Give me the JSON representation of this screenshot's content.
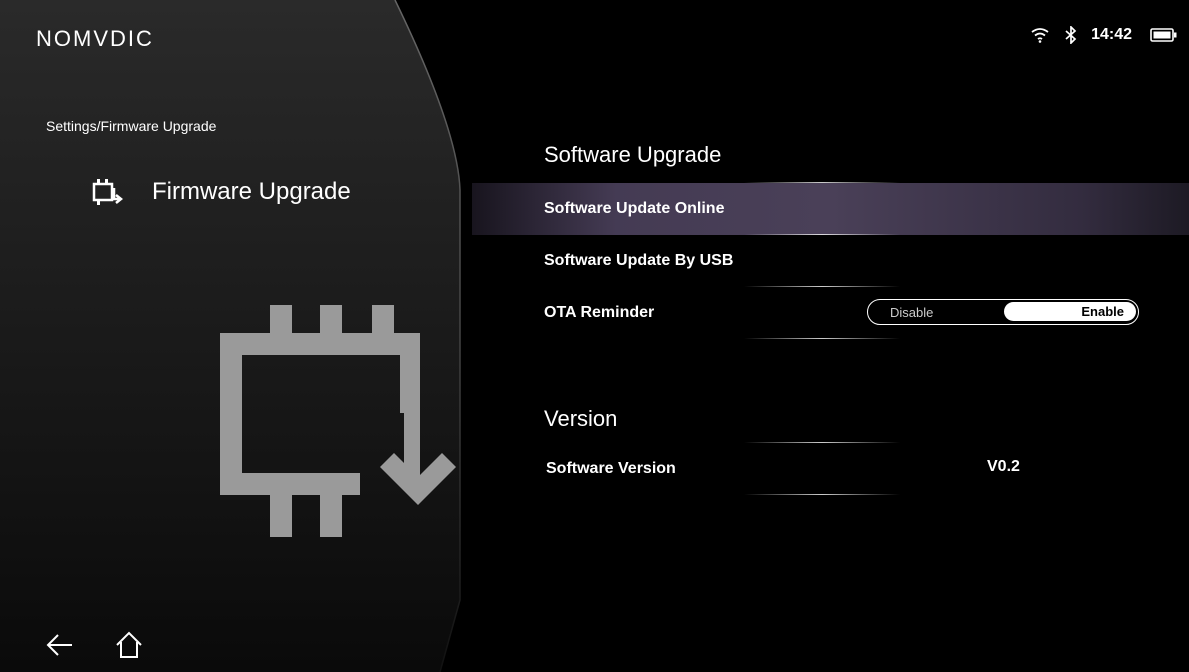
{
  "logo": "NOMVDIC",
  "status": {
    "time": "14:42",
    "icons": [
      "wifi-icon",
      "bluetooth-icon",
      "battery-icon"
    ]
  },
  "breadcrumb": "Settings/Firmware Upgrade",
  "page": {
    "title": "Firmware Upgrade",
    "icon": "firmware-upgrade-icon"
  },
  "software": {
    "title": "Software Upgrade",
    "items": [
      {
        "label": "Software Update Online",
        "selected": true
      },
      {
        "label": "Software Update By USB"
      },
      {
        "label": "OTA Reminder"
      }
    ],
    "ota_toggle": {
      "options": [
        "Disable",
        "Enable"
      ],
      "selected": "Enable"
    }
  },
  "version": {
    "title": "Version",
    "label": "Software Version",
    "value": "V0.2"
  },
  "nav": {
    "back_icon": "back-arrow-icon",
    "home_icon": "home-icon"
  },
  "colors": {
    "background": "#000000",
    "selected_row": "#4a4058",
    "panel": "#1c1c1c",
    "icon_gray": "#9a9a9a"
  }
}
